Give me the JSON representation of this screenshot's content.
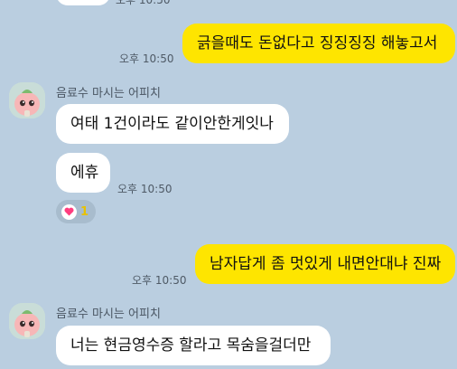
{
  "chat": {
    "top_time_partial": "오후 10:50",
    "messages": [
      {
        "side": "out",
        "text": "긁을때도 돈없다고 징징징징 해놓고서",
        "time": "오후 10:50"
      },
      {
        "side": "in",
        "sender": "음료수 마시는 어피치",
        "text": "여태 1건이라도 같이안한게잇나"
      },
      {
        "side": "in",
        "text": "에휴",
        "time": "오후 10:50"
      },
      {
        "side": "out",
        "text": "남자답게 좀 멋있게 내면안대냐 진짜",
        "time": "오후 10:50"
      },
      {
        "side": "in",
        "sender": "음료수 마시는 어피치",
        "text": "너는 현금영수증 할라고 목숨을걸더만"
      }
    ],
    "reaction": {
      "icon": "heart-icon",
      "count": "1"
    }
  },
  "colors": {
    "background": "#bacee0",
    "outgoing_bubble": "#fee500",
    "incoming_bubble": "#ffffff"
  }
}
